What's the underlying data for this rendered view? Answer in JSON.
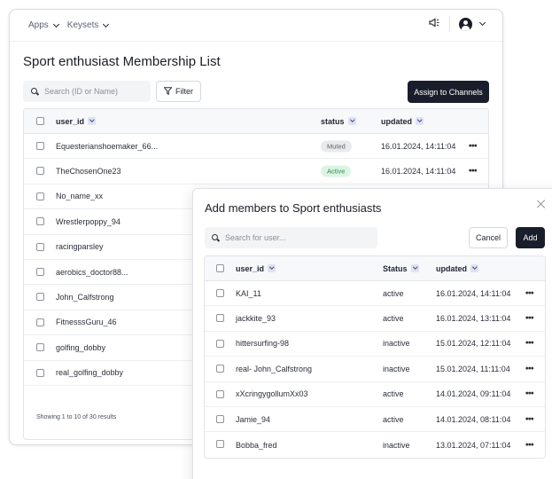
{
  "nav": {
    "apps": "Apps",
    "keysets": "Keysets"
  },
  "page": {
    "title": "Sport enthusiast Membership List"
  },
  "toolbar": {
    "search_placeholder": "Search (ID or Name)",
    "filter_label": "Filter",
    "assign_label": "Assign to Channels"
  },
  "main_table": {
    "columns": {
      "user_id": "user_id",
      "status": "status",
      "updated": "updated"
    },
    "rows": [
      {
        "user_id": "Equesterianshoemaker_66...",
        "status": "Muted",
        "updated": "16.01.2024, 14:11:04",
        "actions": "•••"
      },
      {
        "user_id": "TheChosenOne23",
        "status": "Active",
        "updated": "16.01.2024, 14:11:04",
        "actions": "•••"
      },
      {
        "user_id": "No_name_xx",
        "status": "",
        "updated": "",
        "actions": ""
      },
      {
        "user_id": "Wrestlerpoppy_94",
        "status": "",
        "updated": "",
        "actions": ""
      },
      {
        "user_id": "racingparsley",
        "status": "",
        "updated": "",
        "actions": ""
      },
      {
        "user_id": "aerobics_doctor88...",
        "status": "",
        "updated": "",
        "actions": ""
      },
      {
        "user_id": "John_Calfstrong",
        "status": "",
        "updated": "",
        "actions": ""
      },
      {
        "user_id": "FitnesssGuru_46",
        "status": "",
        "updated": "",
        "actions": ""
      },
      {
        "user_id": "golfing_dobby",
        "status": "",
        "updated": "",
        "actions": ""
      },
      {
        "user_id": "real_golfing_dobby",
        "status": "",
        "updated": "",
        "actions": ""
      }
    ],
    "footer": "Showing 1 to 10 of 30 results"
  },
  "dialog": {
    "title": "Add members to Sport enthusiasts",
    "search_placeholder": "Search for user...",
    "cancel_label": "Cancel",
    "add_label": "Add",
    "columns": {
      "user_id": "user_id",
      "status": "Status",
      "updated": "updated"
    },
    "rows": [
      {
        "user_id": "KAI_11",
        "status": "active",
        "updated": "16.01.2024, 14:11:04",
        "actions": "•••"
      },
      {
        "user_id": "jackkite_93",
        "status": "active",
        "updated": "16.01.2024, 13:11:04",
        "actions": "•••"
      },
      {
        "user_id": "hittersurfing-98",
        "status": "inactive",
        "updated": "15.01.2024, 12:11:04",
        "actions": "•••"
      },
      {
        "user_id": "real- John_Calfstrong",
        "status": "inactive",
        "updated": "15.01.2024, 11:11:04",
        "actions": "•••"
      },
      {
        "user_id": "xXcringygollumXx03",
        "status": "active",
        "updated": "14.01.2024, 09:11:04",
        "actions": "•••"
      },
      {
        "user_id": "Jamie_94",
        "status": "active",
        "updated": "14.01.2024, 08:11:04",
        "actions": "•••"
      },
      {
        "user_id": "Bobba_fred",
        "status": "inactive",
        "updated": "13.01.2024, 07:11:04",
        "actions": "•••"
      }
    ]
  },
  "colors": {
    "primary_button": "#1a1d2b",
    "active_badge_bg": "#dcf5e3",
    "active_badge_text": "#2f8a4c",
    "muted_badge_bg": "#e9eaec"
  },
  "icons": {
    "megaphone": "megaphone-icon",
    "avatar": "user-avatar-icon",
    "search": "search-icon",
    "filter": "filter-icon",
    "close": "close-icon",
    "sort": "sort-chevron-icon",
    "more": "more-dots-icon"
  }
}
